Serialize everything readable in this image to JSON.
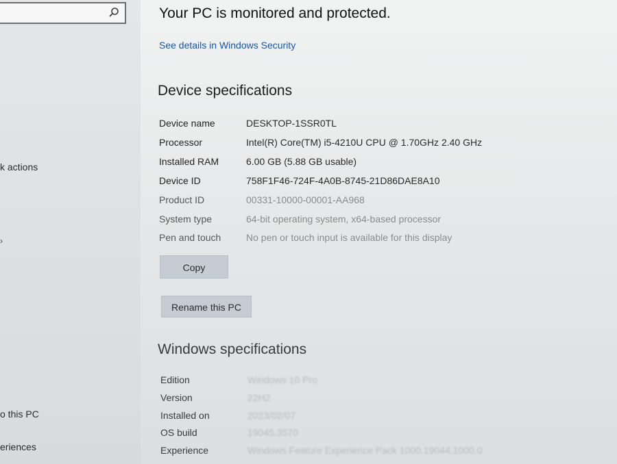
{
  "nav": {
    "search_placeholder": "",
    "items": [
      {
        "label": "k actions"
      },
      {
        "label": "o this PC"
      },
      {
        "label": "eriences"
      }
    ]
  },
  "main": {
    "protection_status": "Your PC is monitored and protected.",
    "security_link": "See details in Windows Security",
    "device_specs": {
      "title": "Device specifications",
      "rows": [
        {
          "label": "Device name",
          "value": "DESKTOP-1SSR0TL"
        },
        {
          "label": "Processor",
          "value": "Intel(R) Core(TM) i5-4210U CPU @ 1.70GHz   2.40 GHz"
        },
        {
          "label": "Installed RAM",
          "value": "6.00 GB (5.88 GB usable)"
        },
        {
          "label": "Device ID",
          "value": "758F1F46-724F-4A0B-8745-21D86DAE8A10"
        },
        {
          "label": "Product ID",
          "value": "00331-10000-00001-AA968"
        },
        {
          "label": "System type",
          "value": "64-bit operating system, x64-based processor"
        },
        {
          "label": "Pen and touch",
          "value": "No pen or touch input is available for this display"
        }
      ],
      "copy_label": "Copy",
      "rename_label": "Rename this PC"
    },
    "windows_specs": {
      "title": "Windows specifications",
      "rows": [
        {
          "label": "Edition",
          "value": "Windows 10 Pro"
        },
        {
          "label": "Version",
          "value": "22H2"
        },
        {
          "label": "Installed on",
          "value": "2023/02/07"
        },
        {
          "label": "OS build",
          "value": "19045.3570"
        },
        {
          "label": "Experience",
          "value": "Windows Feature Experience Pack 1000.19044.1000.0"
        }
      ]
    }
  }
}
